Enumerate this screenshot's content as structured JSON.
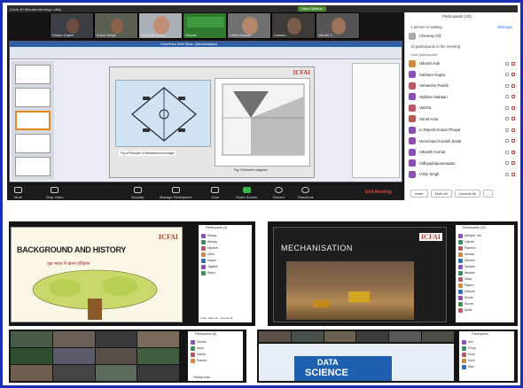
{
  "top_meeting": {
    "window_title": "Zoom 40 Minutes Meeting Lobby",
    "view_options_label": "View Options",
    "tiles": [
      {
        "name": "Himan Gupta"
      },
      {
        "name": "Ankur Singh"
      },
      {
        "name": "Subhash kuma..."
      },
      {
        "name": "Shivani"
      },
      {
        "name": "Chitra Kumari"
      },
      {
        "name": "Chetan..."
      },
      {
        "name": "Vikrant T..."
      }
    ],
    "slide_title_bar": "PowerPoint Slide Show - [Mechanisation]",
    "slide": {
      "logo": "ICFAI",
      "caption_left": "Fig a Principle of Wheatstone's bridge",
      "caption_right": "Fig 2 Edward's diagram"
    },
    "toolbar": [
      {
        "label": "Mute",
        "name": "mute-button"
      },
      {
        "label": "Stop Video",
        "name": "stop-video-button"
      },
      {
        "label": "Security",
        "name": "security-button"
      },
      {
        "label": "Manage Participants",
        "name": "manage-participants-button"
      },
      {
        "label": "Chat",
        "name": "chat-button"
      },
      {
        "label": "Share Screen",
        "name": "share-screen-button"
      },
      {
        "label": "Record",
        "name": "record-button"
      },
      {
        "label": "Reactions",
        "name": "reactions-button"
      }
    ],
    "end_meeting_label": "End Meeting",
    "participants_panel": {
      "title": "Participants (32)",
      "waiting_header": "1 person is waiting",
      "manage_label": "Manage",
      "waiting_person": "Chinmay Gill",
      "in_meeting_header": "10 participants in the meeting",
      "host_label": "Host (participant)",
      "people": [
        {
          "name": "Utkarsh Kali",
          "color": "#d08a3a"
        },
        {
          "name": "Subham Gupta",
          "color": "#8a4fb8"
        },
        {
          "name": "Himanshu Pandit",
          "color": "#c0556a"
        },
        {
          "name": "Tejbhan Mahaan",
          "color": "#8a4fb8"
        },
        {
          "name": "Varsha",
          "color": "#c0556a"
        },
        {
          "name": "Shruti Kotu",
          "color": "#b85a4f"
        },
        {
          "name": "Lt Rajesh Kumar Phuyal",
          "color": "#8a4fb8"
        },
        {
          "name": "Hemchand Kudolli Jindal",
          "color": "#8a4fb8"
        },
        {
          "name": "Vikranth Kumar",
          "color": "#8a4fb8"
        },
        {
          "name": "Vidhyadhipuramadas",
          "color": "#8a4fb8"
        },
        {
          "name": "Vicky Singh",
          "color": "#8a4fb8"
        }
      ],
      "footer_buttons": [
        "Invite",
        "Mute All",
        "Unmute All",
        "..."
      ]
    }
  },
  "mid_left": {
    "slide_title": "BACKGROUND AND HISTORY",
    "subtitle_script": "वृक्ष भारत में खनन इतिहास",
    "logo": "ICFAI",
    "panel_title": "Participants (4)",
    "people": [
      "Sanjay",
      "Akshay",
      "Utkarsh",
      "Hemi",
      "Rayan",
      "Jagdish",
      "Rahul"
    ],
    "footer": [
      "Invite",
      "Mute All",
      "Unmute All"
    ]
  },
  "mid_right": {
    "slide_title": "MECHANISATION",
    "logo": "ICFAI",
    "panel_title": "Participants (32)",
    "people": [
      "Abhijeet Jha",
      "Lakhan",
      "Ramesh",
      "Akshay",
      "Utkarsh",
      "Sanjeev",
      "Naveen",
      "Vikas",
      "Rajeev",
      "Deepak",
      "Sunita",
      "Kumar",
      "Mohit"
    ]
  },
  "bottom_left": {
    "panel_title": "Participants (8)",
    "people": [
      "Dinesh",
      "Arjun",
      "Harish",
      "Rakesh"
    ],
    "footer": "Pankaj Shah"
  },
  "bottom_right": {
    "slide_title_line1": "DATA",
    "slide_title_line2": "SCIENCE",
    "panel_title": "Participants",
    "people": [
      "Anil",
      "Pooja",
      "Kiran",
      "Sunil",
      "Ravi"
    ]
  }
}
